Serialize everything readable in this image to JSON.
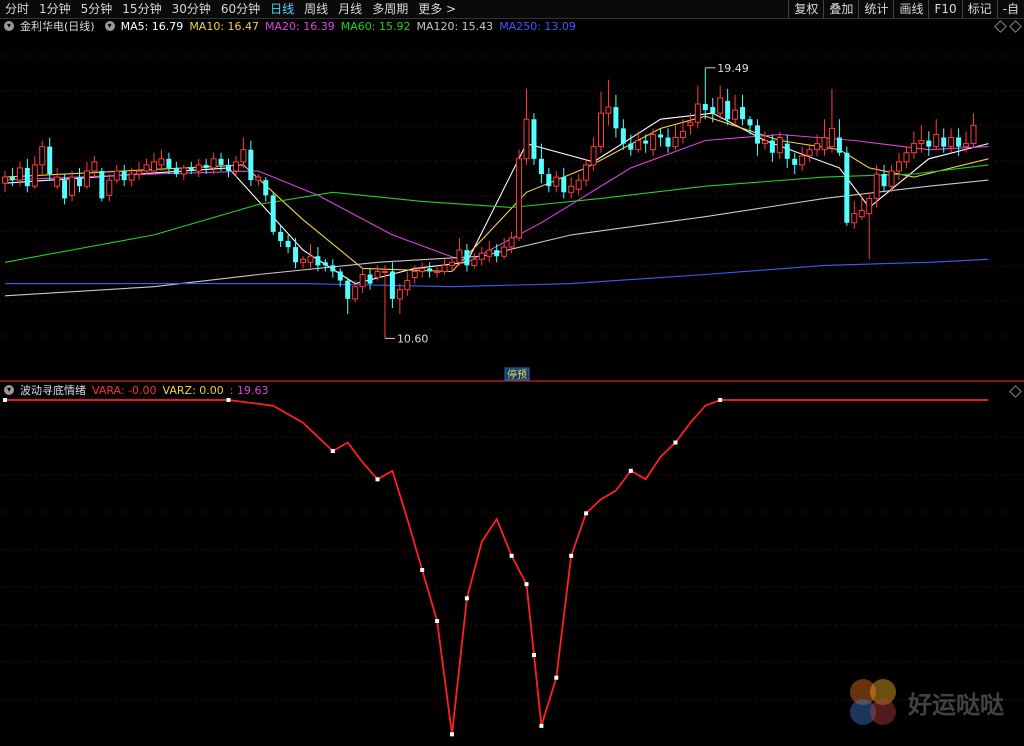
{
  "toolbar": {
    "timeframes": [
      "分时",
      "1分钟",
      "5分钟",
      "15分钟",
      "30分钟",
      "60分钟",
      "日线",
      "周线",
      "月线",
      "多周期",
      "更多 >"
    ],
    "active_index": 6,
    "right_tools": [
      "复权",
      "叠加",
      "统计",
      "画线",
      "F10",
      "标记",
      "-自"
    ]
  },
  "info": {
    "stock": "金利华电(日线)",
    "ma": [
      {
        "label": "MA5: 16.79",
        "color": "#ffffff"
      },
      {
        "label": "MA10: 16.47",
        "color": "#f5d142"
      },
      {
        "label": "MA20: 16.39",
        "color": "#e040e0"
      },
      {
        "label": "MA60: 15.92",
        "color": "#22d022"
      },
      {
        "label": "MA120: 15.43",
        "color": "#c8c8c8"
      },
      {
        "label": "MA250: 13.09",
        "color": "#3a5cff"
      }
    ]
  },
  "chart_data": {
    "type": "candlestick",
    "price_range": [
      9.3,
      20.6
    ],
    "max_label": "19.49",
    "min_label": "10.60",
    "marker_label": "停预",
    "candles": [
      [
        15.7,
        15.9,
        16.1,
        15.4
      ],
      [
        15.9,
        15.8,
        16.2,
        15.6
      ],
      [
        15.8,
        16.2,
        16.4,
        15.6
      ],
      [
        16.2,
        15.6,
        16.5,
        15.4
      ],
      [
        15.6,
        16.3,
        16.6,
        15.5
      ],
      [
        16.3,
        16.9,
        17.1,
        16.0
      ],
      [
        16.9,
        16.0,
        17.2,
        15.8
      ],
      [
        15.6,
        15.9,
        16.2,
        15.5
      ],
      [
        15.8,
        15.2,
        16.0,
        15.0
      ],
      [
        15.3,
        15.9,
        16.1,
        15.1
      ],
      [
        15.9,
        15.6,
        16.2,
        15.4
      ],
      [
        15.6,
        16.1,
        16.4,
        15.5
      ],
      [
        16.1,
        16.4,
        16.6,
        15.9
      ],
      [
        16.1,
        15.2,
        16.2,
        15.1
      ],
      [
        15.3,
        15.8,
        16.0,
        15.1
      ],
      [
        15.8,
        16.1,
        16.3,
        15.7
      ],
      [
        16.1,
        15.8,
        16.3,
        15.6
      ],
      [
        15.8,
        16.0,
        16.2,
        15.6
      ],
      [
        16.0,
        16.1,
        16.4,
        15.8
      ],
      [
        16.1,
        16.3,
        16.5,
        16.0
      ],
      [
        16.1,
        16.4,
        16.7,
        16.0
      ],
      [
        16.3,
        16.5,
        16.8,
        16.1
      ],
      [
        16.5,
        16.2,
        16.7,
        16.0
      ],
      [
        16.2,
        16.0,
        16.4,
        15.9
      ],
      [
        16.0,
        16.2,
        16.3,
        15.8
      ],
      [
        16.2,
        16.1,
        16.4,
        16.0
      ],
      [
        16.1,
        16.3,
        16.5,
        15.9
      ],
      [
        16.3,
        16.2,
        16.5,
        16.0
      ],
      [
        16.2,
        16.5,
        16.7,
        16.0
      ],
      [
        16.5,
        16.3,
        16.7,
        16.1
      ],
      [
        16.3,
        16.1,
        16.5,
        15.9
      ],
      [
        16.1,
        16.4,
        16.6,
        15.9
      ],
      [
        16.4,
        16.8,
        17.2,
        16.2
      ],
      [
        16.8,
        15.8,
        17.1,
        15.6
      ],
      [
        15.8,
        15.9,
        16.0,
        15.6
      ],
      [
        15.8,
        15.3,
        15.9,
        15.1
      ],
      [
        15.3,
        14.1,
        15.4,
        14.0
      ],
      [
        14.1,
        13.8,
        14.3,
        13.6
      ],
      [
        13.8,
        13.6,
        14.0,
        13.4
      ],
      [
        13.6,
        13.1,
        13.9,
        12.9
      ],
      [
        13.1,
        13.2,
        13.3,
        12.9
      ],
      [
        13.1,
        13.3,
        13.7,
        12.9
      ],
      [
        13.3,
        13.0,
        13.6,
        12.8
      ],
      [
        13.1,
        13.0,
        13.2,
        12.8
      ],
      [
        13.0,
        12.8,
        13.2,
        12.6
      ],
      [
        12.8,
        12.5,
        12.9,
        12.3
      ],
      [
        12.5,
        11.9,
        12.6,
        11.4
      ],
      [
        11.9,
        12.3,
        12.5,
        11.8
      ],
      [
        12.3,
        12.7,
        12.9,
        12.1
      ],
      [
        12.7,
        12.4,
        12.9,
        12.2
      ],
      [
        12.6,
        12.8,
        13.0,
        12.5
      ],
      [
        12.8,
        12.8,
        13.0,
        10.6
      ],
      [
        12.8,
        11.9,
        13.1,
        11.6
      ],
      [
        11.9,
        12.2,
        12.4,
        11.4
      ],
      [
        12.2,
        12.5,
        12.8,
        12.0
      ],
      [
        12.6,
        12.8,
        13.0,
        12.4
      ],
      [
        12.8,
        12.9,
        13.1,
        12.6
      ],
      [
        12.9,
        12.8,
        13.1,
        12.6
      ],
      [
        12.8,
        12.8,
        13.0,
        12.6
      ],
      [
        12.8,
        13.0,
        13.2,
        12.7
      ],
      [
        13.0,
        13.1,
        13.3,
        12.8
      ],
      [
        13.1,
        13.5,
        13.9,
        13.0
      ],
      [
        13.5,
        13.0,
        13.7,
        12.8
      ],
      [
        13.0,
        13.2,
        13.4,
        12.9
      ],
      [
        13.2,
        13.4,
        13.6,
        13.0
      ],
      [
        13.3,
        13.5,
        13.8,
        13.1
      ],
      [
        13.5,
        13.3,
        13.7,
        13.1
      ],
      [
        13.3,
        13.6,
        13.9,
        13.2
      ],
      [
        13.6,
        13.9,
        14.1,
        13.4
      ],
      [
        13.9,
        16.5,
        16.8,
        13.8
      ],
      [
        16.5,
        17.8,
        18.8,
        16.3
      ],
      [
        17.8,
        16.5,
        18.0,
        16.3
      ],
      [
        16.5,
        16.0,
        17.0,
        15.7
      ],
      [
        16.0,
        15.6,
        16.2,
        15.4
      ],
      [
        15.6,
        15.9,
        16.1,
        15.4
      ],
      [
        15.9,
        15.4,
        16.2,
        15.2
      ],
      [
        15.4,
        15.6,
        15.9,
        15.2
      ],
      [
        15.5,
        15.8,
        16.0,
        15.3
      ],
      [
        15.8,
        16.3,
        16.5,
        15.6
      ],
      [
        16.3,
        16.9,
        17.2,
        16.1
      ],
      [
        16.9,
        18.0,
        18.7,
        16.7
      ],
      [
        18.0,
        18.2,
        19.1,
        17.6
      ],
      [
        18.2,
        17.5,
        18.6,
        17.2
      ],
      [
        17.5,
        17.0,
        17.8,
        16.8
      ],
      [
        17.0,
        16.8,
        17.3,
        16.6
      ],
      [
        16.8,
        17.1,
        17.4,
        16.7
      ],
      [
        17.1,
        17.0,
        17.3,
        16.7
      ],
      [
        16.8,
        17.3,
        17.5,
        16.6
      ],
      [
        17.3,
        17.2,
        17.5,
        16.9
      ],
      [
        17.2,
        16.9,
        17.5,
        16.7
      ],
      [
        16.9,
        17.2,
        17.6,
        16.8
      ],
      [
        17.2,
        17.4,
        17.8,
        17.0
      ],
      [
        17.6,
        17.7,
        18.0,
        17.3
      ],
      [
        17.7,
        18.3,
        18.9,
        17.5
      ],
      [
        18.3,
        18.1,
        19.49,
        17.8
      ],
      [
        18.2,
        18.0,
        18.5,
        17.7
      ],
      [
        18.0,
        18.5,
        18.9,
        17.8
      ],
      [
        18.4,
        17.8,
        18.8,
        17.6
      ],
      [
        17.8,
        18.1,
        18.6,
        17.6
      ],
      [
        18.2,
        17.8,
        18.6,
        17.6
      ],
      [
        17.8,
        17.6,
        17.9,
        17.3
      ],
      [
        17.6,
        17.0,
        17.8,
        16.6
      ],
      [
        17.0,
        17.1,
        17.4,
        16.8
      ],
      [
        17.1,
        16.7,
        17.3,
        16.4
      ],
      [
        16.7,
        17.2,
        17.4,
        16.5
      ],
      [
        17.0,
        16.5,
        17.3,
        16.2
      ],
      [
        16.5,
        16.3,
        16.7,
        16.0
      ],
      [
        16.3,
        16.6,
        16.9,
        16.1
      ],
      [
        16.6,
        16.8,
        17.0,
        16.4
      ],
      [
        16.8,
        17.0,
        17.3,
        16.6
      ],
      [
        16.8,
        17.2,
        17.8,
        16.6
      ],
      [
        16.9,
        17.5,
        18.8,
        16.7
      ],
      [
        17.2,
        16.7,
        17.8,
        16.6
      ],
      [
        16.7,
        14.4,
        16.9,
        14.3
      ],
      [
        14.4,
        14.7,
        15.1,
        14.2
      ],
      [
        14.6,
        14.8,
        15.3,
        14.5
      ],
      [
        14.7,
        15.2,
        15.4,
        13.2
      ],
      [
        15.2,
        16.0,
        16.3,
        14.9
      ],
      [
        16.0,
        15.6,
        16.3,
        15.4
      ],
      [
        15.6,
        16.1,
        16.3,
        15.4
      ],
      [
        16.1,
        16.4,
        16.7,
        15.8
      ],
      [
        16.4,
        16.7,
        16.9,
        16.2
      ],
      [
        16.7,
        17.0,
        17.4,
        16.5
      ],
      [
        17.0,
        17.1,
        17.6,
        16.7
      ],
      [
        17.1,
        16.9,
        17.4,
        16.6
      ],
      [
        16.9,
        17.3,
        17.8,
        16.8
      ],
      [
        17.2,
        16.9,
        17.5,
        16.7
      ],
      [
        16.9,
        17.2,
        17.5,
        16.7
      ],
      [
        17.2,
        16.9,
        17.5,
        16.6
      ],
      [
        16.9,
        17.0,
        17.4,
        16.7
      ],
      [
        17.0,
        17.6,
        18.0,
        16.9
      ]
    ],
    "ma_series": [
      {
        "name": "MA5",
        "color": "#ffffff",
        "values": [
          [
            0,
            15.7
          ],
          [
            30,
            16.2
          ],
          [
            40,
            13.5
          ],
          [
            47,
            12.4
          ],
          [
            55,
            12.9
          ],
          [
            62,
            13.1
          ],
          [
            70,
            17.0
          ],
          [
            79,
            16.4
          ],
          [
            88,
            17.8
          ],
          [
            95,
            18.0
          ],
          [
            102,
            17.1
          ],
          [
            112,
            16.2
          ],
          [
            116,
            14.9
          ],
          [
            124,
            16.5
          ],
          [
            132,
            17.0
          ]
        ]
      },
      {
        "name": "MA10",
        "color": "#f5d142",
        "values": [
          [
            0,
            15.9
          ],
          [
            32,
            16.3
          ],
          [
            40,
            14.5
          ],
          [
            48,
            12.9
          ],
          [
            60,
            12.8
          ],
          [
            70,
            15.4
          ],
          [
            78,
            16.2
          ],
          [
            88,
            17.5
          ],
          [
            94,
            17.9
          ],
          [
            104,
            17.1
          ],
          [
            112,
            16.8
          ],
          [
            116,
            16.2
          ],
          [
            122,
            15.9
          ],
          [
            132,
            16.5
          ]
        ]
      },
      {
        "name": "MA20",
        "color": "#e040e0",
        "values": [
          [
            0,
            15.8
          ],
          [
            20,
            16.0
          ],
          [
            34,
            16.1
          ],
          [
            42,
            15.3
          ],
          [
            52,
            14.0
          ],
          [
            62,
            13.1
          ],
          [
            72,
            14.4
          ],
          [
            84,
            16.2
          ],
          [
            94,
            17.1
          ],
          [
            104,
            17.3
          ],
          [
            114,
            17.1
          ],
          [
            124,
            16.8
          ],
          [
            132,
            16.9
          ]
        ]
      },
      {
        "name": "MA60",
        "color": "#22d022",
        "values": [
          [
            0,
            13.1
          ],
          [
            20,
            14.0
          ],
          [
            34,
            15.0
          ],
          [
            44,
            15.4
          ],
          [
            56,
            15.1
          ],
          [
            68,
            14.9
          ],
          [
            80,
            15.2
          ],
          [
            94,
            15.6
          ],
          [
            110,
            15.9
          ],
          [
            122,
            16.0
          ],
          [
            132,
            16.3
          ]
        ]
      },
      {
        "name": "MA120",
        "color": "#c8c8c8",
        "values": [
          [
            0,
            12.0
          ],
          [
            20,
            12.3
          ],
          [
            34,
            12.7
          ],
          [
            50,
            13.1
          ],
          [
            64,
            13.3
          ],
          [
            76,
            14.0
          ],
          [
            94,
            14.6
          ],
          [
            110,
            15.2
          ],
          [
            124,
            15.6
          ],
          [
            132,
            15.8
          ]
        ]
      },
      {
        "name": "MA250",
        "color": "#3a5cff",
        "values": [
          [
            0,
            12.4
          ],
          [
            20,
            12.4
          ],
          [
            40,
            12.4
          ],
          [
            60,
            12.3
          ],
          [
            76,
            12.4
          ],
          [
            94,
            12.7
          ],
          [
            110,
            13.0
          ],
          [
            124,
            13.1
          ],
          [
            132,
            13.2
          ]
        ]
      }
    ],
    "indicator": {
      "name": "波动寻底情绪",
      "labels": [
        {
          "text": "VARA: -0.00",
          "color": "#ff3030"
        },
        {
          "text": "VARZ: 0.00",
          "color": "#f5d142"
        },
        {
          "text": ": 19.63",
          "color": "#e040e0"
        }
      ],
      "range": [
        -120,
        0
      ],
      "values": [
        [
          0,
          0
        ],
        [
          10,
          0
        ],
        [
          20,
          0
        ],
        [
          30,
          0
        ],
        [
          36,
          -2
        ],
        [
          40,
          -8
        ],
        [
          44,
          -18
        ],
        [
          46,
          -15
        ],
        [
          48,
          -22
        ],
        [
          50,
          -28
        ],
        [
          52,
          -25
        ],
        [
          54,
          -42
        ],
        [
          56,
          -60
        ],
        [
          58,
          -78
        ],
        [
          60,
          -118
        ],
        [
          62,
          -70
        ],
        [
          64,
          -50
        ],
        [
          66,
          -42
        ],
        [
          68,
          -55
        ],
        [
          70,
          -65
        ],
        [
          71,
          -90
        ],
        [
          72,
          -115
        ],
        [
          74,
          -98
        ],
        [
          76,
          -55
        ],
        [
          78,
          -40
        ],
        [
          80,
          -35
        ],
        [
          82,
          -32
        ],
        [
          84,
          -25
        ],
        [
          86,
          -28
        ],
        [
          88,
          -20
        ],
        [
          90,
          -15
        ],
        [
          92,
          -8
        ],
        [
          94,
          -2
        ],
        [
          96,
          0
        ],
        [
          132,
          0
        ]
      ]
    }
  },
  "watermark": "好运哒哒"
}
